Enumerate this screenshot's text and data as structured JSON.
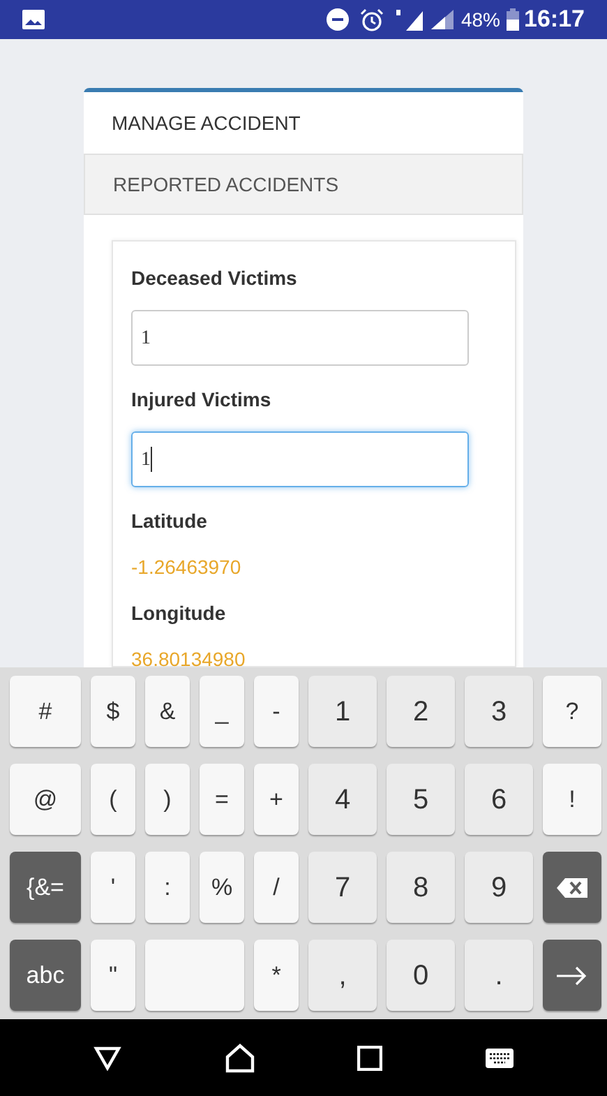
{
  "status_bar": {
    "battery": "48%",
    "time": "16:17"
  },
  "tabs": [
    {
      "label": "MANAGE ACCIDENT",
      "selected": true
    },
    {
      "label": "REPORTED ACCIDENTS",
      "selected": false
    }
  ],
  "form": {
    "fields": [
      {
        "kind": "input",
        "label": "Deceased Victims",
        "value": "1",
        "focused": false
      },
      {
        "kind": "input",
        "label": "Injured Victims",
        "value": "1",
        "focused": true
      },
      {
        "kind": "reading",
        "label": "Latitude",
        "value": "-1.26463970"
      },
      {
        "kind": "reading",
        "label": "Longitude",
        "value": "36.80134980"
      }
    ]
  },
  "keyboard": {
    "rows": [
      {
        "keys": [
          {
            "kind": "symbol",
            "label": "#"
          },
          {
            "kind": "symbol",
            "label": "$"
          },
          {
            "kind": "symbol",
            "label": "&"
          },
          {
            "kind": "symbol",
            "label": "_"
          },
          {
            "kind": "symbol",
            "label": "-"
          },
          {
            "kind": "number",
            "label": "1"
          },
          {
            "kind": "number",
            "label": "2"
          },
          {
            "kind": "number",
            "label": "3"
          },
          {
            "kind": "symbol",
            "label": "?"
          }
        ]
      },
      {
        "keys": [
          {
            "kind": "symbol",
            "label": "@"
          },
          {
            "kind": "symbol",
            "label": "("
          },
          {
            "kind": "symbol",
            "label": ")"
          },
          {
            "kind": "symbol",
            "label": "="
          },
          {
            "kind": "symbol",
            "label": "+"
          },
          {
            "kind": "number",
            "label": "4"
          },
          {
            "kind": "number",
            "label": "5"
          },
          {
            "kind": "number",
            "label": "6"
          },
          {
            "kind": "symbol",
            "label": "!"
          }
        ]
      },
      {
        "keys": [
          {
            "kind": "function",
            "label": "{&="
          },
          {
            "kind": "symbol",
            "label": "'"
          },
          {
            "kind": "symbol",
            "label": ":"
          },
          {
            "kind": "symbol",
            "label": "%"
          },
          {
            "kind": "symbol",
            "label": "/"
          },
          {
            "kind": "number",
            "label": "7"
          },
          {
            "kind": "number",
            "label": "8"
          },
          {
            "kind": "number",
            "label": "9"
          },
          {
            "kind": "backspace"
          }
        ]
      },
      {
        "keys": [
          {
            "kind": "function",
            "label": "abc"
          },
          {
            "kind": "symbol",
            "label": "\""
          },
          {
            "kind": "space"
          },
          {
            "kind": "symbol",
            "label": "*"
          },
          {
            "kind": "number",
            "label": ","
          },
          {
            "kind": "number",
            "label": "0"
          },
          {
            "kind": "number",
            "label": "."
          },
          {
            "kind": "enter"
          }
        ]
      }
    ]
  }
}
